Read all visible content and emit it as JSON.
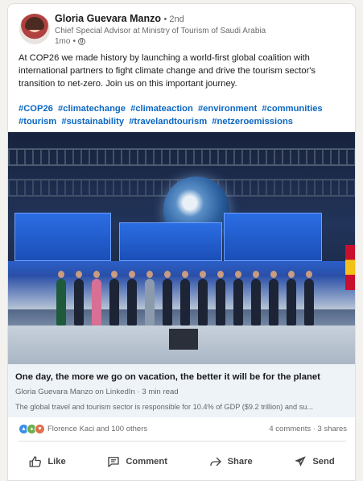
{
  "post": {
    "author_name": "Gloria Guevara Manzo",
    "degree": "2nd",
    "headline": "Chief Special Advisor at Ministry of Tourism of Saudi Arabia",
    "time": "1mo",
    "text": "At COP26 we made history by launching a world-first global coalition with international partners to fight climate change and drive the tourism sector's transition to net-zero. Join us on this important journey.",
    "hashtags": [
      "#COP26",
      "#climatechange",
      "#climateaction",
      "#environment",
      "#communities",
      "#tourism",
      "#sustainability",
      "#travelandtourism",
      "#netzeroemissions"
    ]
  },
  "article": {
    "title": "One day, the more we go on vacation, the better it will be for the planet",
    "source": "Gloria Guevara Manzo on LinkedIn · 3 min read",
    "description": "The global travel and tourism sector is responsible for 10.4% of GDP ($9.2 trillion) and su..."
  },
  "social": {
    "reactions_text": "Florence Kaci and 100 others",
    "counts_text": "4 comments · 3 shares",
    "reaction_icons": [
      "like-icon",
      "celebrate-icon",
      "love-icon"
    ]
  },
  "actions": {
    "like": "Like",
    "comment": "Comment",
    "share": "Share",
    "send": "Send"
  },
  "colors": {
    "link_blue": "#0a66c2",
    "article_bg": "#eef3f8"
  }
}
